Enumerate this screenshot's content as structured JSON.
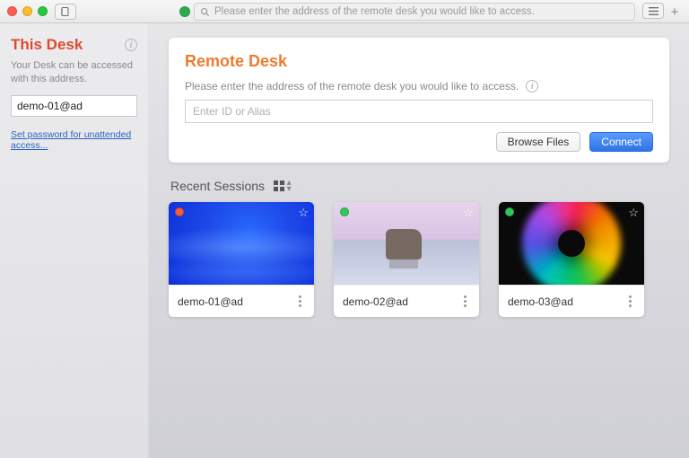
{
  "topbar": {
    "address_placeholder": "Please enter the address of the remote desk you would like to access."
  },
  "sidebar": {
    "title": "This Desk",
    "subtitle": "Your Desk can be accessed with this address.",
    "id_value": "demo-01@ad",
    "link_text": "Set password for unattended access..."
  },
  "remote": {
    "title": "Remote Desk",
    "subtitle": "Please enter the address of the remote desk you would like to access.",
    "input_placeholder": "Enter ID or Alias",
    "browse_label": "Browse Files",
    "connect_label": "Connect"
  },
  "recent": {
    "heading": "Recent Sessions",
    "items": [
      {
        "label": "demo-01@ad",
        "status": "offline"
      },
      {
        "label": "demo-02@ad",
        "status": "online"
      },
      {
        "label": "demo-03@ad",
        "status": "online"
      }
    ]
  }
}
